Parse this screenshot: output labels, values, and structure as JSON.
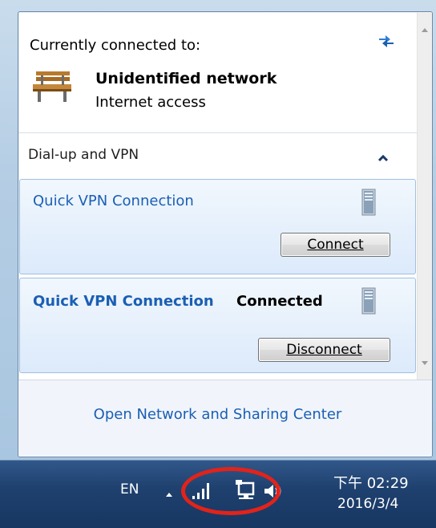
{
  "network": {
    "heading": "Currently connected to:",
    "name": "Unidentified network",
    "status": "Internet access"
  },
  "vpn_group": {
    "title": "Dial-up and VPN",
    "connections": [
      {
        "name": "Quick VPN Connection",
        "state": "",
        "button": "Connect"
      },
      {
        "name": "Quick VPN Connection",
        "state": "Connected",
        "button": "Disconnect"
      }
    ]
  },
  "footer": {
    "link": "Open Network and Sharing Center"
  },
  "taskbar": {
    "language": "EN",
    "time": "下午 02:29",
    "date": "2016/3/4"
  },
  "colors": {
    "link_blue": "#1a5fb4",
    "highlight_ring": "#e2231a",
    "taskbar": "#1f416f"
  },
  "icons": [
    "refresh-icon",
    "bench-network-icon",
    "chevron-up-icon",
    "server-icon",
    "signal-icon",
    "network-tray-icon",
    "volume-icon",
    "tray-arrow-icon"
  ]
}
